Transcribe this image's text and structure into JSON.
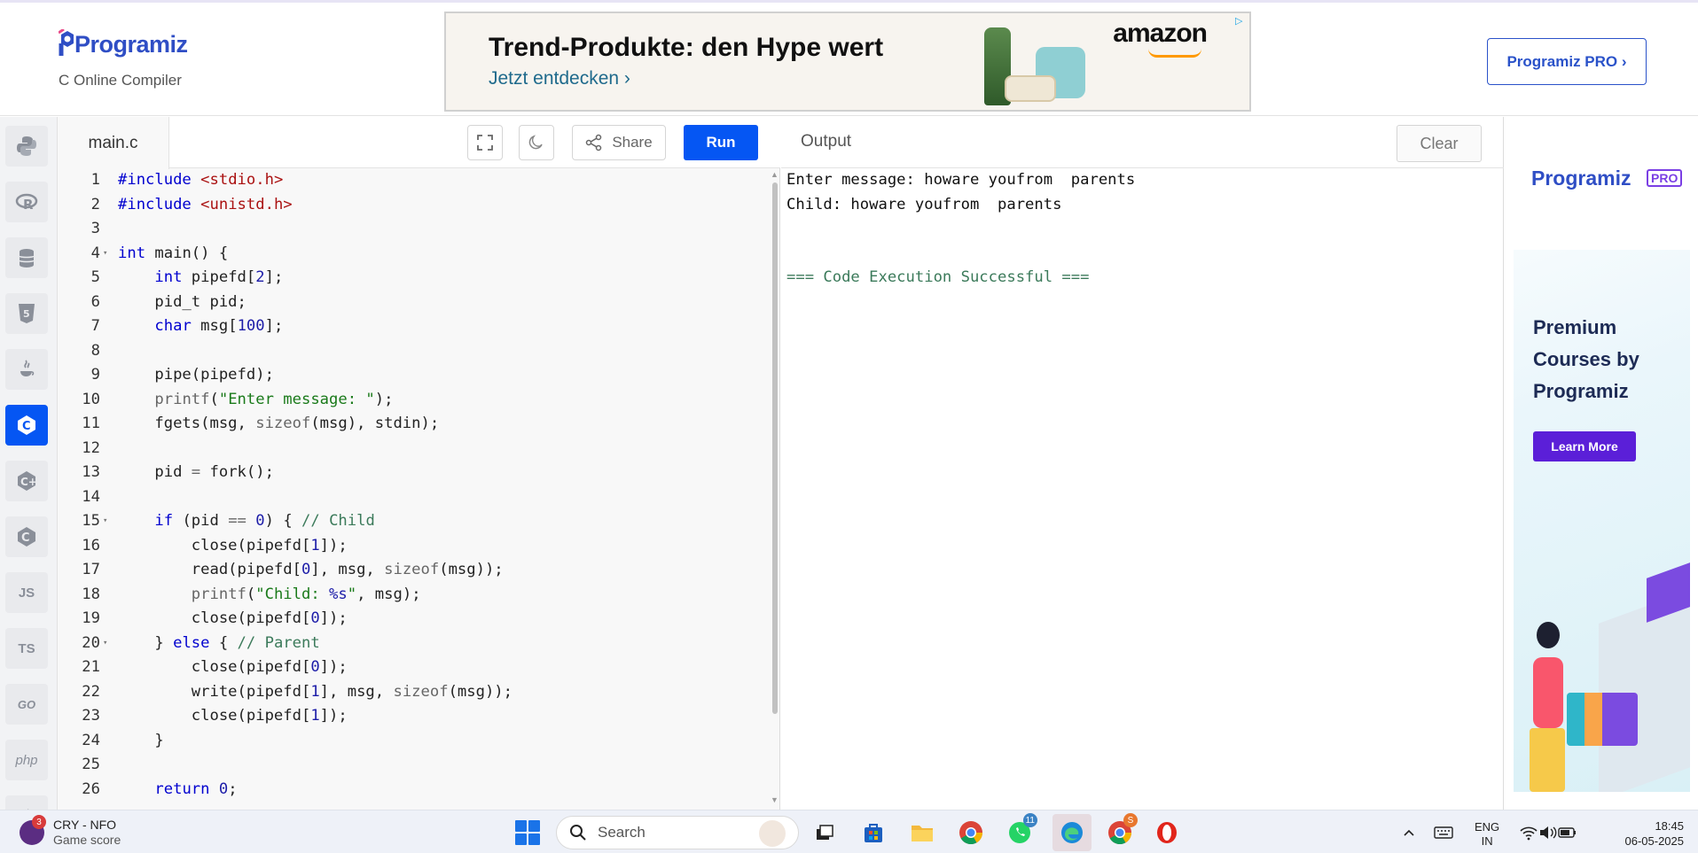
{
  "header": {
    "logo_text": "Programiz",
    "logo_sub": "C Online Compiler",
    "pro_button": "Programiz PRO ›"
  },
  "ad_banner": {
    "title": "Trend-Produkte: den Hype wert",
    "link": "Jetzt entdecken ›",
    "brand": "amazon"
  },
  "sidebar": {
    "items": [
      {
        "name": "python",
        "label": ""
      },
      {
        "name": "r",
        "label": ""
      },
      {
        "name": "sql",
        "label": ""
      },
      {
        "name": "html",
        "label": ""
      },
      {
        "name": "java",
        "label": ""
      },
      {
        "name": "c",
        "label": ""
      },
      {
        "name": "cpp",
        "label": ""
      },
      {
        "name": "csharp",
        "label": ""
      },
      {
        "name": "js",
        "label": "JS"
      },
      {
        "name": "ts",
        "label": "TS"
      },
      {
        "name": "go",
        "label": "GO"
      },
      {
        "name": "php",
        "label": "php"
      }
    ],
    "active": "c"
  },
  "editor": {
    "file_name": "main.c",
    "share_label": "Share",
    "run_label": "Run",
    "lines": [
      {
        "n": "1",
        "fold": false,
        "code": "#include <stdio.h>"
      },
      {
        "n": "2",
        "fold": false,
        "code": "#include <unistd.h>"
      },
      {
        "n": "3",
        "fold": false,
        "code": ""
      },
      {
        "n": "4",
        "fold": true,
        "code": "int main() {"
      },
      {
        "n": "5",
        "fold": false,
        "code": "    int pipefd[2];"
      },
      {
        "n": "6",
        "fold": false,
        "code": "    pid_t pid;"
      },
      {
        "n": "7",
        "fold": false,
        "code": "    char msg[100];"
      },
      {
        "n": "8",
        "fold": false,
        "code": ""
      },
      {
        "n": "9",
        "fold": false,
        "code": "    pipe(pipefd);"
      },
      {
        "n": "10",
        "fold": false,
        "code": "    printf(\"Enter message: \");"
      },
      {
        "n": "11",
        "fold": false,
        "code": "    fgets(msg, sizeof(msg), stdin);"
      },
      {
        "n": "12",
        "fold": false,
        "code": ""
      },
      {
        "n": "13",
        "fold": false,
        "code": "    pid = fork();"
      },
      {
        "n": "14",
        "fold": false,
        "code": ""
      },
      {
        "n": "15",
        "fold": true,
        "code": "    if (pid == 0) { // Child"
      },
      {
        "n": "16",
        "fold": false,
        "code": "        close(pipefd[1]);"
      },
      {
        "n": "17",
        "fold": false,
        "code": "        read(pipefd[0], msg, sizeof(msg));"
      },
      {
        "n": "18",
        "fold": false,
        "code": "        printf(\"Child: %s\", msg);"
      },
      {
        "n": "19",
        "fold": false,
        "code": "        close(pipefd[0]);"
      },
      {
        "n": "20",
        "fold": true,
        "code": "    } else { // Parent"
      },
      {
        "n": "21",
        "fold": false,
        "code": "        close(pipefd[0]);"
      },
      {
        "n": "22",
        "fold": false,
        "code": "        write(pipefd[1], msg, sizeof(msg));"
      },
      {
        "n": "23",
        "fold": false,
        "code": "        close(pipefd[1]);"
      },
      {
        "n": "24",
        "fold": false,
        "code": "    }"
      },
      {
        "n": "25",
        "fold": false,
        "code": ""
      },
      {
        "n": "26",
        "fold": false,
        "code": "    return 0;"
      }
    ]
  },
  "output": {
    "title": "Output",
    "clear_label": "Clear",
    "lines": [
      "Enter message: howare youfrom  parents",
      "Child: howare youfrom  parents",
      "",
      "",
      "=== Code Execution Successful ==="
    ]
  },
  "right_ad": {
    "logo": "Programiz",
    "badge": "PRO",
    "heading": "Premium Courses by Programiz",
    "button": "Learn More"
  },
  "taskbar": {
    "news_title": "CRY - NFO",
    "news_sub": "Game score",
    "news_badge": "3",
    "search_placeholder": "Search",
    "whatsapp_badge": "11",
    "chrome_badge": "S",
    "lang_top": "ENG",
    "lang_bottom": "IN",
    "time": "18:45",
    "date": "06-05-2025"
  }
}
